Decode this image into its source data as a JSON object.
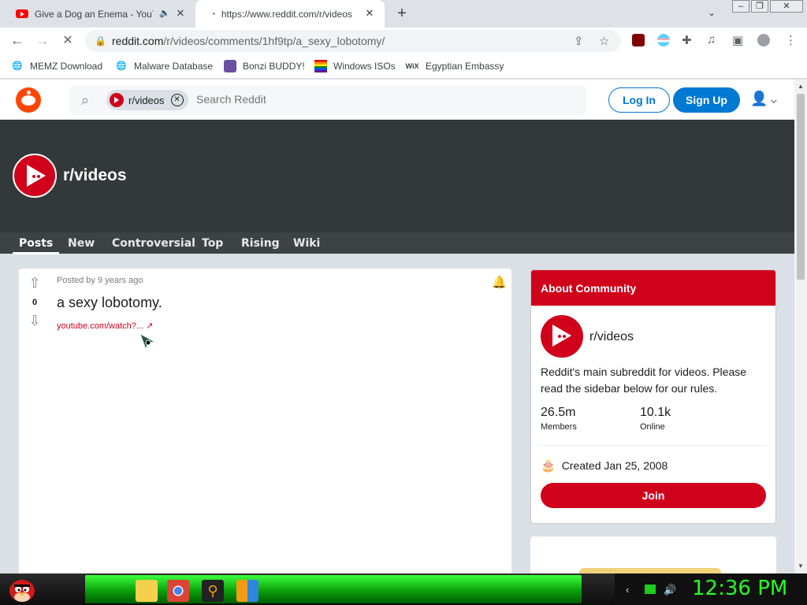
{
  "browser": {
    "tabs": [
      {
        "title": "Give a Dog an Enema - YouT"
      },
      {
        "title": "https://www.reddit.com/r/videos"
      }
    ],
    "new_tab": "+",
    "url_domain": "reddit.com",
    "url_path": "/r/videos/comments/1hf9tp/a_sexy_lobotomy/"
  },
  "bookmarks": [
    {
      "label": "MEMZ Download",
      "icon": "globe-icon"
    },
    {
      "label": "Malware Database",
      "icon": "globe-icon"
    },
    {
      "label": "Bonzi BUDDY!",
      "icon": "bonzi-icon"
    },
    {
      "label": "Windows ISOs",
      "icon": "windows-flag-icon"
    },
    {
      "label": "Egyptian Embassy",
      "icon": "wix-icon",
      "icon_text": "WiX"
    }
  ],
  "reddit_header": {
    "search_chip": "r/videos",
    "search_placeholder": "Search Reddit",
    "login": "Log In",
    "signup": "Sign Up"
  },
  "subreddit": {
    "name": "r/videos",
    "nav": [
      "Posts",
      "New",
      "Controversial",
      "Top",
      "Rising",
      "Wiki"
    ]
  },
  "post": {
    "meta": "Posted by 9 years ago",
    "score": "0",
    "title": "a sexy lobotomy.",
    "link": "youtube.com/watch?..."
  },
  "about": {
    "header": "About Community",
    "name": "r/videos",
    "description": "Reddit's main subreddit for videos. Please read the sidebar below for our rules.",
    "members_value": "26.5m",
    "members_label": "Members",
    "online_value": "10.1k",
    "online_label": "Online",
    "created": "Created Jan 25, 2008",
    "join": "Join"
  },
  "taskbar": {
    "clock": "12:36 PM"
  },
  "colors": {
    "reddit_orange": "#ff4500",
    "subreddit_red": "#d0021b",
    "reddit_blue": "#0079d3",
    "banner_dark": "#33383a",
    "clock_green": "#22ff22"
  }
}
